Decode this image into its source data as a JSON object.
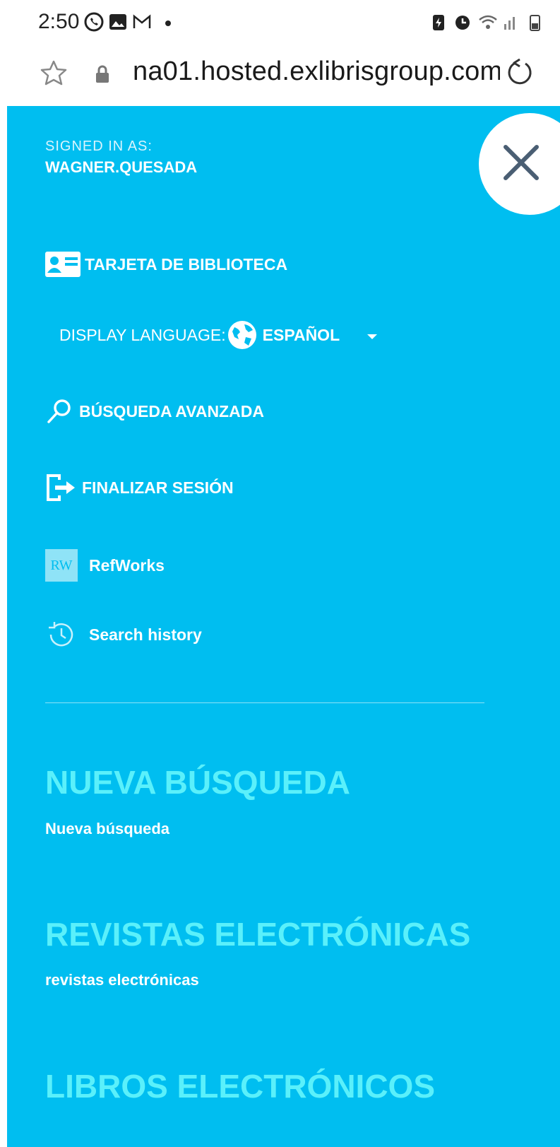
{
  "status_bar": {
    "time": "2:50",
    "left_icons": [
      "whatsapp-icon",
      "gallery-icon",
      "gmail-icon",
      "dot-icon"
    ],
    "right_icons": [
      "battery-saver-icon",
      "alarm-icon",
      "wifi-icon",
      "signal-icon",
      "battery-icon"
    ]
  },
  "browser": {
    "url": "na01.hosted.exlibrisgroup.com"
  },
  "drawer": {
    "signed_in_label": "SIGNED IN AS:",
    "username": "WAGNER.QUESADA",
    "items": [
      {
        "label": "TARJETA DE BIBLIOTECA",
        "icon": "id-card-icon"
      },
      {
        "label": "BÚSQUEDA AVANZADA",
        "icon": "search-icon"
      },
      {
        "label": "FINALIZAR SESIÓN",
        "icon": "logout-icon"
      },
      {
        "label": "RefWorks",
        "icon": "refworks-icon",
        "icon_text": "RW"
      },
      {
        "label": "Search history",
        "icon": "history-icon"
      }
    ],
    "language": {
      "label": "DISPLAY LANGUAGE:",
      "value": "ESPAÑOL"
    },
    "sections": [
      {
        "title": "NUEVA BÚSQUEDA",
        "link": "Nueva búsqueda"
      },
      {
        "title": "REVISTAS ELECTRÓNICAS",
        "link": "revistas electrónicas"
      },
      {
        "title": "LIBROS ELECTRÓNICOS",
        "link": ""
      }
    ]
  },
  "colors": {
    "drawer_bg": "#00bef0",
    "section_title": "#5af0fb",
    "text": "#ffffff"
  }
}
